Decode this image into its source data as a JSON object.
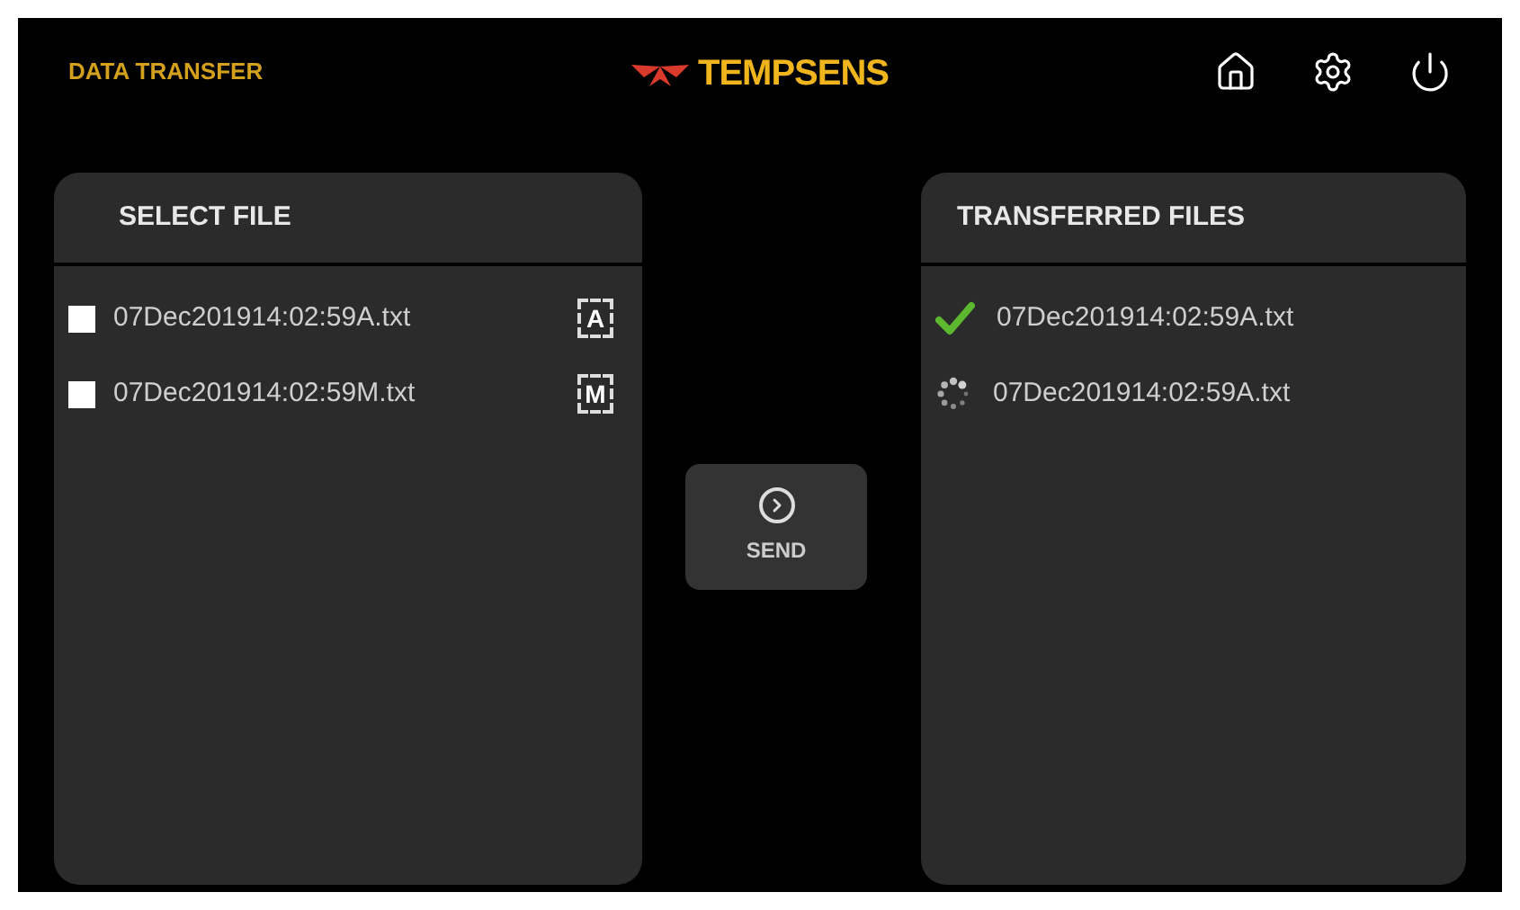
{
  "header": {
    "title": "DATA TRANSFER",
    "logo": "TEMPSENS"
  },
  "select_panel": {
    "title": "SELECT FILE",
    "files": [
      {
        "name": "07Dec201914:02:59A.txt",
        "checked": false,
        "badge": "A"
      },
      {
        "name": "07Dec201914:02:59M.txt",
        "checked": false,
        "badge": "M"
      }
    ]
  },
  "send_button": {
    "label": "SEND"
  },
  "transferred_panel": {
    "title": "TRANSFERRED FILES",
    "files": [
      {
        "name": "07Dec201914:02:59A.txt",
        "complete": true
      },
      {
        "name": "07Dec201914:02:59A.txt",
        "complete": false
      }
    ]
  }
}
